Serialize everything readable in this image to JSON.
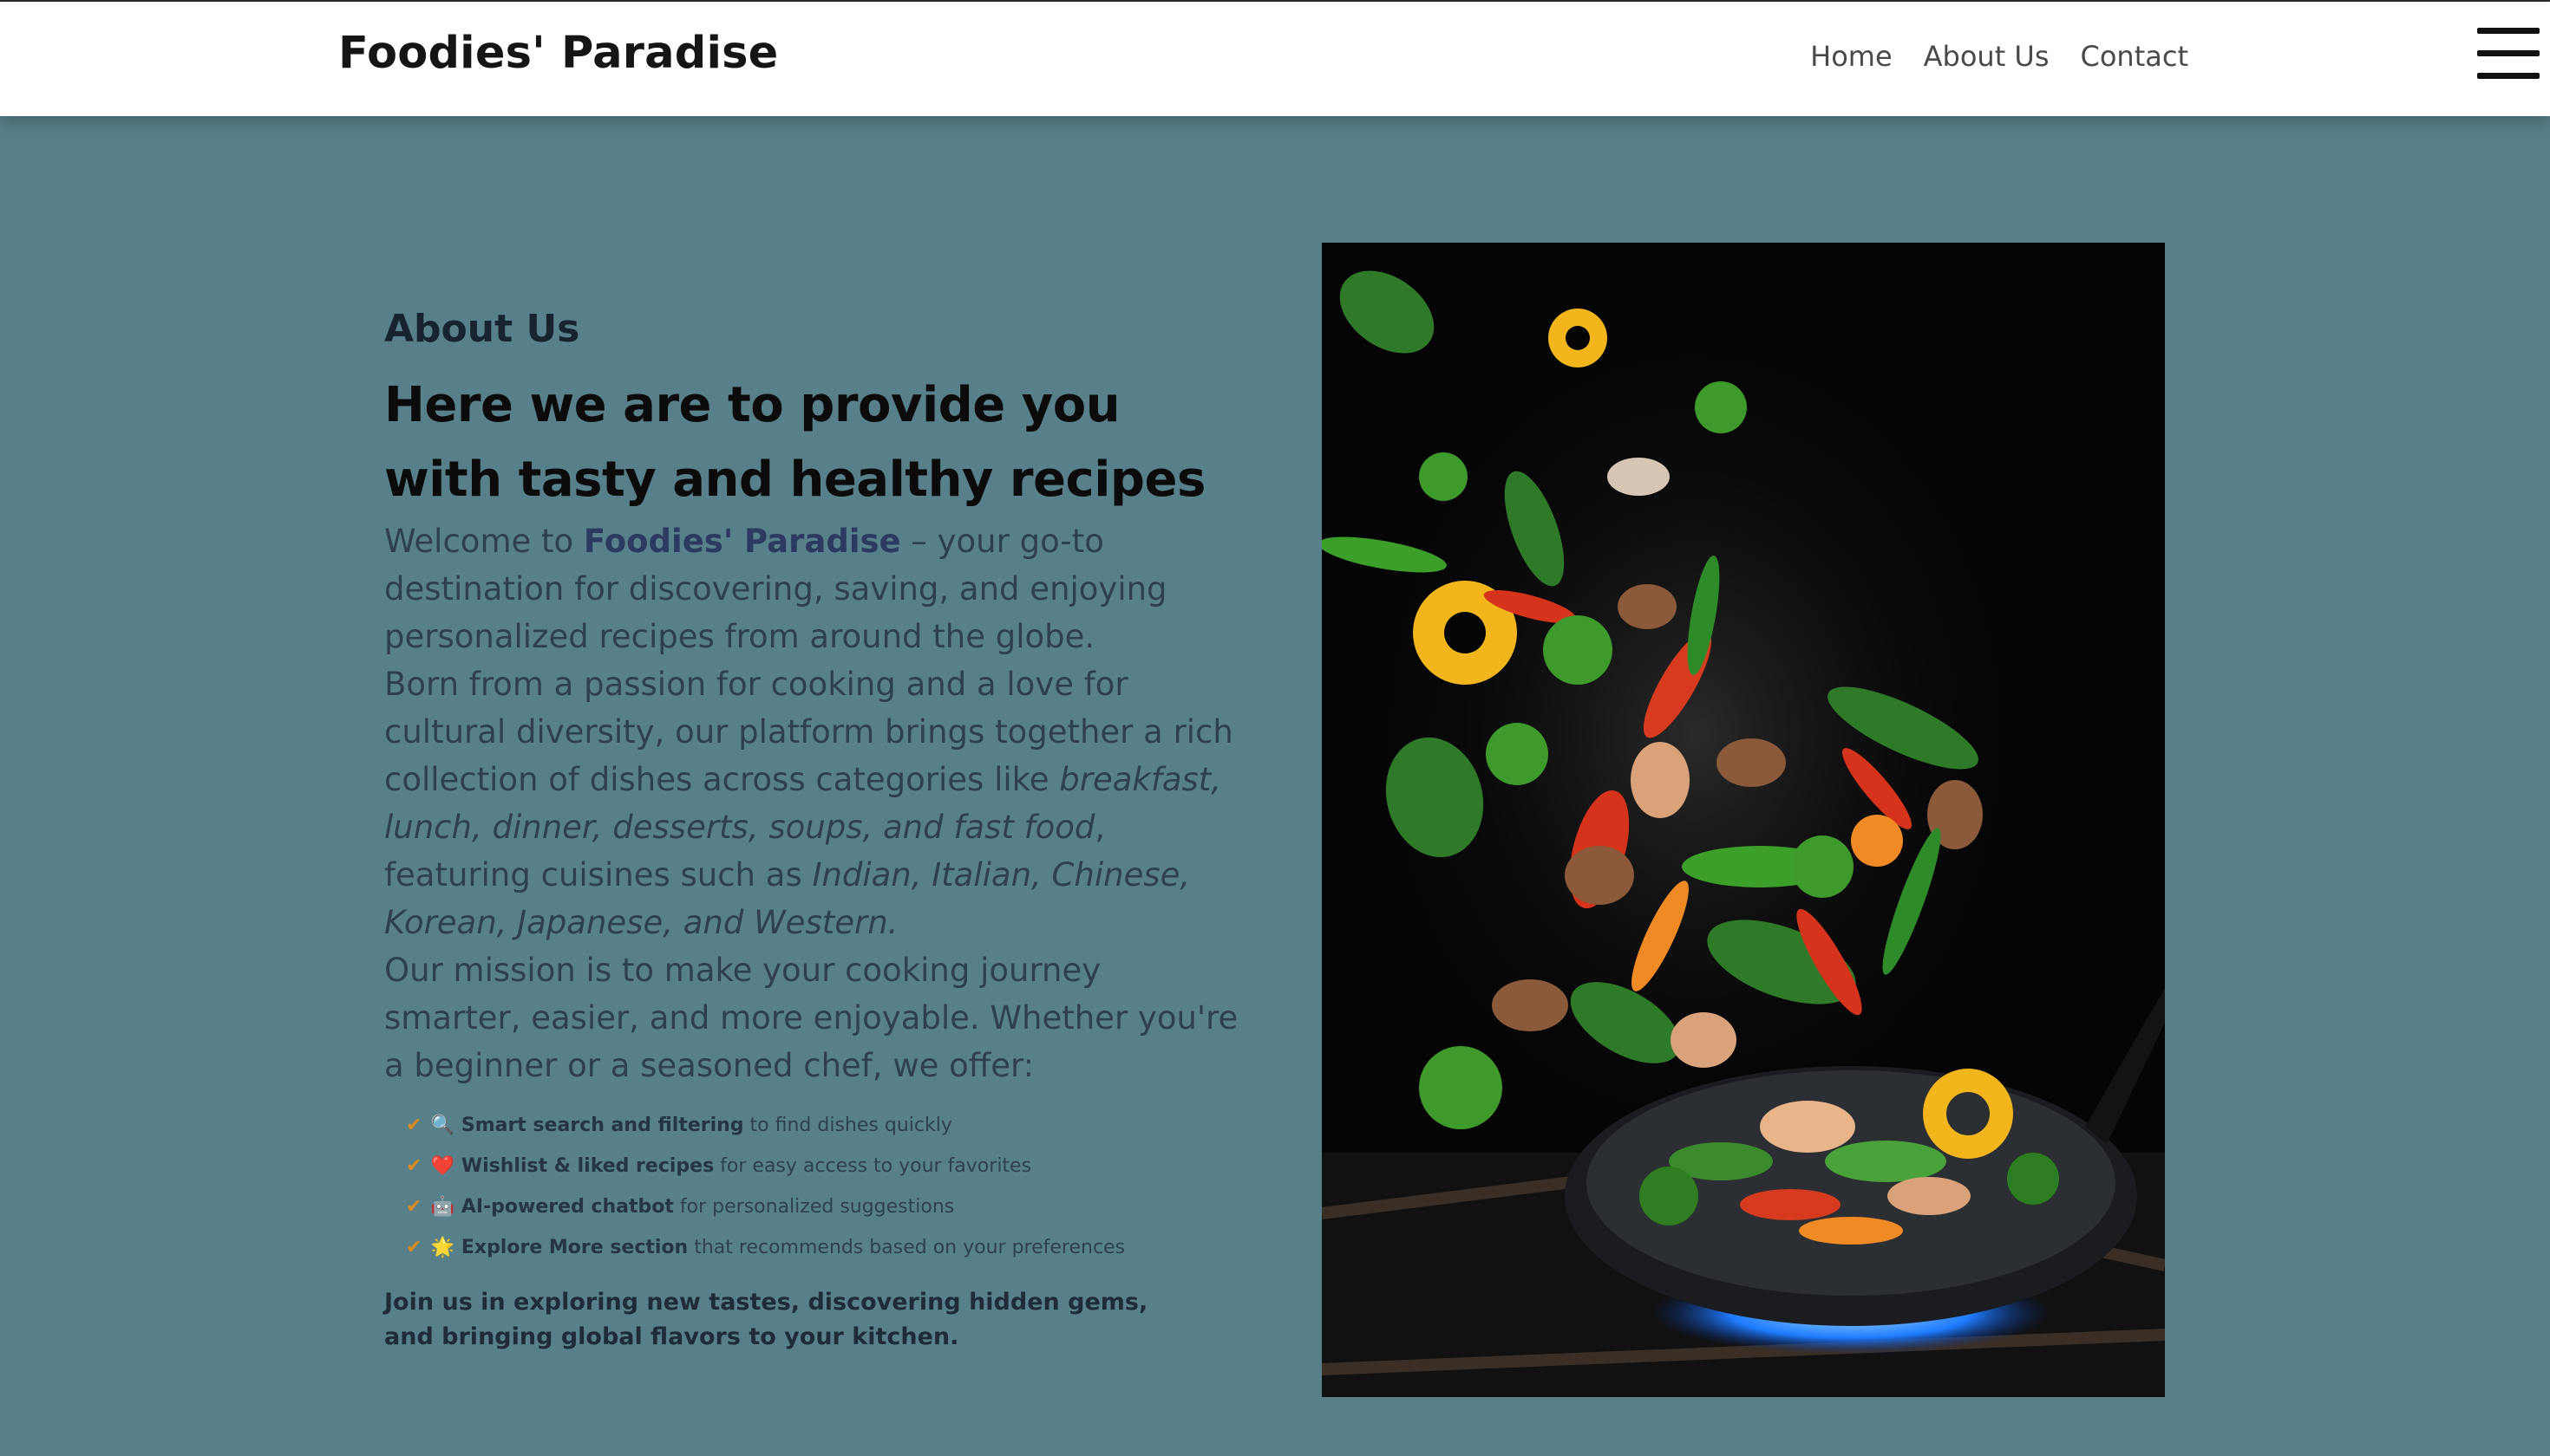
{
  "header": {
    "brand": "Foodies' Paradise",
    "nav": [
      "Home",
      "About Us",
      "Contact"
    ]
  },
  "about": {
    "label": "About Us",
    "headline": "Here we are to provide you with tasty and healthy recipes",
    "intro": {
      "welcome": "Welcome to ",
      "brand": "Foodies' Paradise",
      "rest": " – your go-to destination for discovering, saving, and enjoying personalized recipes from around the globe."
    },
    "story": {
      "lead": "Born from a passion for cooking and a love for cultural diversity, our platform brings together a rich collection of dishes across categories like ",
      "categories": "breakfast, lunch, dinner, desserts, soups, and fast food",
      "mid": ", featuring cuisines such as ",
      "cuisines": "Indian, Italian, Chinese, Korean, Japanese, and Western."
    },
    "mission": "Our mission is to make your cooking journey smarter, easier, and more enjoyable. Whether you're a beginner or a seasoned chef, we offer:",
    "offers": [
      {
        "check": "✔",
        "emoji": "🔍",
        "bold": "Smart search and filtering",
        "text": " to find dishes quickly"
      },
      {
        "check": "✔",
        "emoji": "❤️",
        "bold": "Wishlist & liked recipes",
        "text": " for easy access to your favorites"
      },
      {
        "check": "✔",
        "emoji": "🤖",
        "bold": "AI-powered chatbot",
        "text": " for personalized suggestions"
      },
      {
        "check": "✔",
        "emoji": "🌟",
        "bold": "Explore More section",
        "text": " that recommends based on your preferences"
      }
    ],
    "closing": "Join us in exploring new tastes, discovering hidden gems, and bringing global flavors to your kitchen."
  },
  "colors": {
    "page_bg": "#58808a",
    "header_bg": "#ffffff",
    "check": "#d98b1e"
  },
  "icons": {
    "menu": "hamburger-menu-icon"
  }
}
